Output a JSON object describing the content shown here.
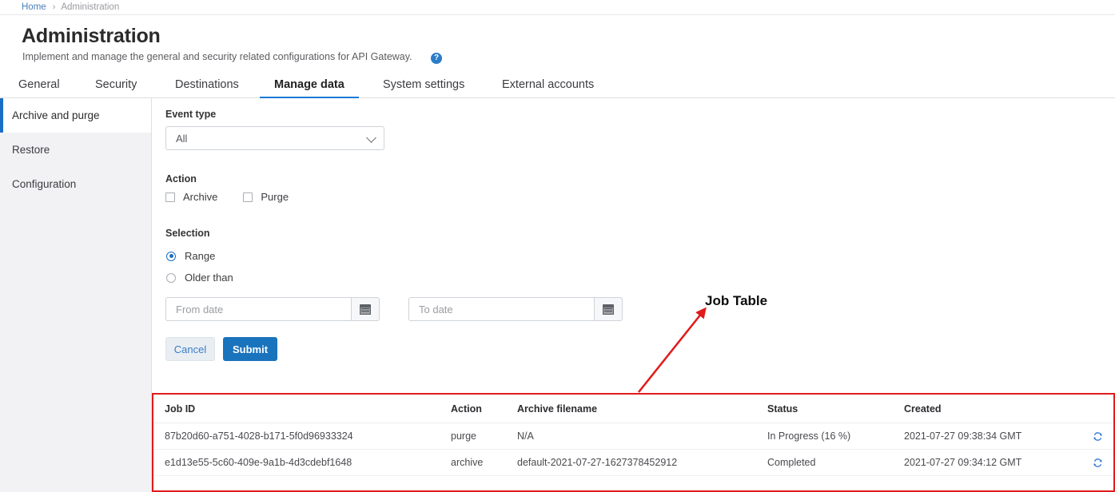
{
  "breadcrumb": {
    "home": "Home",
    "separator": "›",
    "current": "Administration"
  },
  "header": {
    "title": "Administration",
    "subtitle": "Implement and manage the general and security related configurations for API Gateway.",
    "help_icon": "help-circle-icon",
    "help_glyph": "?"
  },
  "tabs": [
    {
      "label": "General",
      "active": false
    },
    {
      "label": "Security",
      "active": false
    },
    {
      "label": "Destinations",
      "active": false
    },
    {
      "label": "Manage data",
      "active": true
    },
    {
      "label": "System settings",
      "active": false
    },
    {
      "label": "External accounts",
      "active": false
    }
  ],
  "sidebar": {
    "items": [
      {
        "label": "Archive and purge",
        "active": true
      },
      {
        "label": "Restore",
        "active": false
      },
      {
        "label": "Configuration",
        "active": false
      }
    ]
  },
  "form": {
    "event_type": {
      "label": "Event type",
      "value": "All"
    },
    "action": {
      "label": "Action",
      "checkboxes": [
        {
          "label": "Archive",
          "checked": false
        },
        {
          "label": "Purge",
          "checked": false
        }
      ]
    },
    "selection": {
      "label": "Selection",
      "radios": [
        {
          "label": "Range",
          "checked": true
        },
        {
          "label": "Older than",
          "checked": false
        }
      ]
    },
    "from_date": {
      "placeholder": "From date",
      "value": "",
      "icon": "calendar-icon"
    },
    "to_date": {
      "placeholder": "To date",
      "value": "",
      "icon": "calendar-icon"
    },
    "cancel_label": "Cancel",
    "submit_label": "Submit"
  },
  "annotation": {
    "label": "Job Table",
    "color": "#e01b1b"
  },
  "job_table": {
    "columns": [
      "Job ID",
      "Action",
      "Archive filename",
      "Status",
      "Created"
    ],
    "rows": [
      {
        "job_id": "87b20d60-a751-4028-b171-5f0d96933324",
        "action": "purge",
        "filename": "N/A",
        "status": "In Progress (16 %)",
        "created": "2021-07-27 09:38:34 GMT",
        "icon": "refresh-icon"
      },
      {
        "job_id": "e1d13e55-5c60-409e-9a1b-4d3cdebf1648",
        "action": "archive",
        "filename": "default-2021-07-27-1627378452912",
        "status": "Completed",
        "created": "2021-07-27 09:34:12 GMT",
        "icon": "refresh-icon"
      }
    ]
  },
  "colors": {
    "accent": "#1a73bd",
    "link": "#4a7ebb",
    "annotation": "#e01b1b"
  }
}
